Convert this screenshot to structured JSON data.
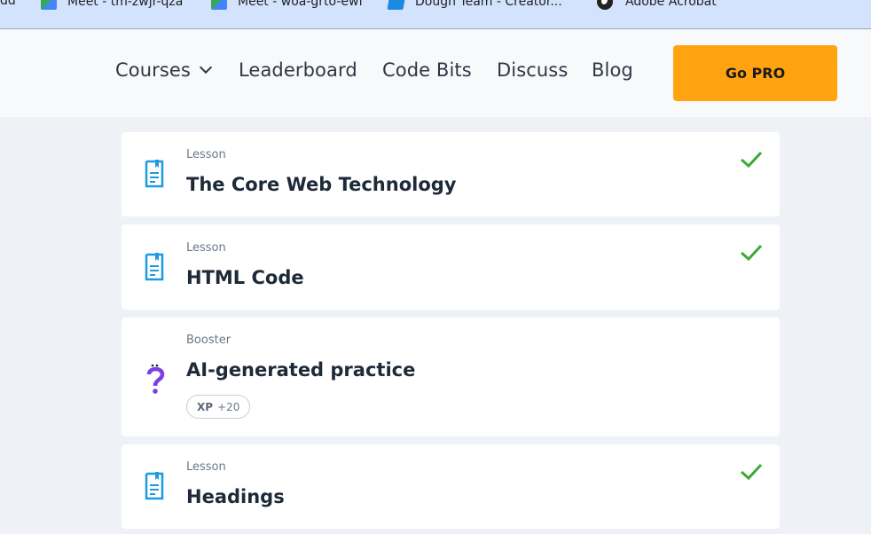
{
  "bookmarks": [
    {
      "label": "dd",
      "icon": "none"
    },
    {
      "label": "Meet - tm-zwjr-qza",
      "icon": "meet-icon"
    },
    {
      "label": "Meet - woa-grto-ewf",
      "icon": "meet-icon"
    },
    {
      "label": "Dough Team - Creator...",
      "icon": "dough-icon"
    },
    {
      "label": "Adobe Acrobat",
      "icon": "globe-icon"
    }
  ],
  "nav": {
    "courses": "Courses",
    "leaderboard": "Leaderboard",
    "code_bits": "Code Bits",
    "discuss": "Discuss",
    "blog": "Blog",
    "go_pro": "Go PRO"
  },
  "colors": {
    "accent": "#ffa310",
    "check": "#3aaa35",
    "lesson_icon": "#1e9be0",
    "booster_icon": "#7b3fe4",
    "background": "#eef2f6"
  },
  "cards": [
    {
      "type": "Lesson",
      "title": "The Core Web Technology",
      "completed": true,
      "icon": "lesson-doc-icon"
    },
    {
      "type": "Lesson",
      "title": "HTML Code",
      "completed": true,
      "icon": "lesson-doc-icon"
    },
    {
      "type": "Booster",
      "title": "AI-generated practice",
      "completed": false,
      "icon": "question-mark-icon",
      "xp_label": "XP",
      "xp_value": "+20"
    },
    {
      "type": "Lesson",
      "title": "Headings",
      "completed": true,
      "icon": "lesson-doc-icon"
    }
  ]
}
